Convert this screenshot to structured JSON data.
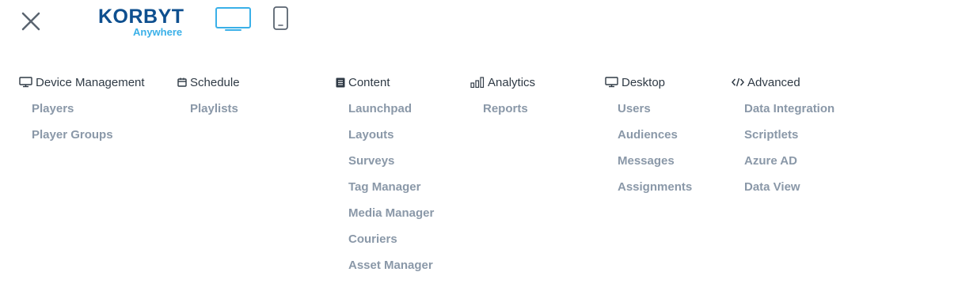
{
  "header": {
    "logo": {
      "text": "KORBYT",
      "subtext": "Anywhere",
      "primary_color": "#0e4f8f",
      "accent_color": "#3ab0e8"
    },
    "close_icon": "close-icon",
    "view_toggle": {
      "desktop_icon": "desktop-monitor-icon",
      "mobile_icon": "mobile-phone-icon",
      "active": "desktop",
      "active_color": "#3ab0e8",
      "inactive_color": "#5a6470"
    }
  },
  "menu": {
    "columns": [
      {
        "title": "Device Management",
        "icon": "monitor-icon",
        "items": [
          "Players",
          "Player Groups"
        ]
      },
      {
        "title": "Schedule",
        "icon": "calendar-icon",
        "items": [
          "Playlists"
        ]
      },
      {
        "title": "Content",
        "icon": "document-icon",
        "items": [
          "Launchpad",
          "Layouts",
          "Surveys",
          "Tag Manager",
          "Media Manager",
          "Couriers",
          "Asset Manager"
        ]
      },
      {
        "title": "Analytics",
        "icon": "bar-chart-icon",
        "items": [
          "Reports"
        ]
      },
      {
        "title": "Desktop",
        "icon": "monitor-icon",
        "items": [
          "Users",
          "Audiences",
          "Messages",
          "Assignments"
        ]
      },
      {
        "title": "Advanced",
        "icon": "code-icon",
        "items": [
          "Data Integration",
          "Scriptlets",
          "Azure AD",
          "Data View"
        ]
      }
    ]
  },
  "colors": {
    "header_text": "#2f3a45",
    "item_text": "#8a98a8"
  }
}
